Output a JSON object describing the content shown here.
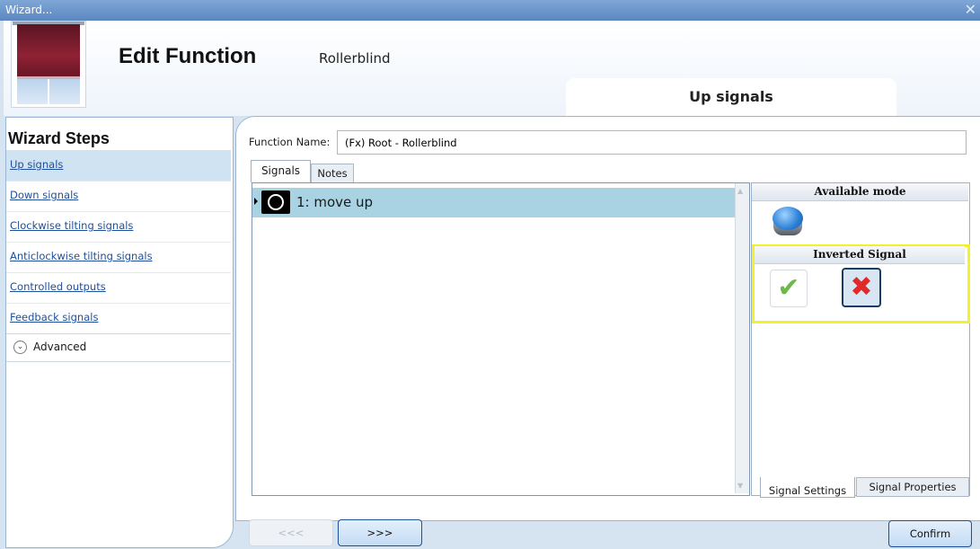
{
  "window": {
    "title": "Wizard...",
    "close_glyph": "✕"
  },
  "header": {
    "title": "Edit Function",
    "subtitle": "Rollerblind",
    "current_step": "Up signals",
    "logo_icon": "rollerblind-icon"
  },
  "sidebar": {
    "title": "Wizard Steps",
    "steps": [
      {
        "label": "Up signals",
        "selected": true
      },
      {
        "label": "Down signals",
        "selected": false
      },
      {
        "label": "Clockwise tilting signals",
        "selected": false
      },
      {
        "label": "Anticlockwise tilting signals",
        "selected": false
      },
      {
        "label": "Controlled outputs",
        "selected": false
      },
      {
        "label": "Feedback signals",
        "selected": false
      }
    ],
    "advanced": {
      "label": "Advanced",
      "icon": "chevron-down-circle-icon"
    }
  },
  "function_name": {
    "label": "Function Name:",
    "value": "(Fx) Root - Rollerblind"
  },
  "tabs": [
    {
      "label": "Signals",
      "active": true
    },
    {
      "label": "Notes",
      "active": false
    }
  ],
  "signals": [
    {
      "label": "1: move up",
      "icon": "signal-circle-icon",
      "selected": true
    }
  ],
  "settings": {
    "available_mode": {
      "title": "Available mode",
      "icon": "blue-pushbutton-icon"
    },
    "inverted_signal": {
      "title": "Inverted Signal",
      "yes_icon": "checkmark-icon",
      "no_icon": "red-x-icon",
      "selected": "no",
      "highlight_color": "#f2f22a"
    },
    "tabs": [
      {
        "label": "Signal Settings",
        "active": true
      },
      {
        "label": "Signal Properties",
        "active": false
      }
    ]
  },
  "buttons": {
    "prev": "<<<",
    "next": ">>>",
    "confirm": "Confirm"
  }
}
